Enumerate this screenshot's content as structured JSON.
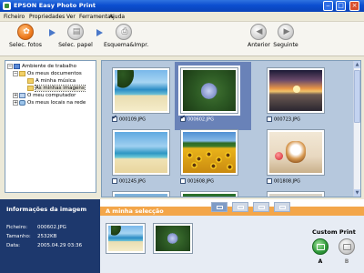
{
  "window": {
    "title": "EPSON Easy Photo Print"
  },
  "menu": [
    "Ficheiro",
    "Propriedades",
    "Ver",
    "Ferramentas",
    "Ajuda"
  ],
  "toolbar": {
    "steps": [
      {
        "label": "Selec. fotos",
        "icon": "photo-select-icon",
        "state": "active"
      },
      {
        "label": "Selec. papel",
        "icon": "paper-icon",
        "state": "idle"
      },
      {
        "label": "Esquema&Impr.",
        "icon": "print-icon",
        "state": "idle"
      }
    ],
    "prev_label": "Anterior",
    "next_label": "Seguinte",
    "accent": "#ee7b1f"
  },
  "tree": {
    "items": [
      {
        "label": "Ambiente de trabalho",
        "icon": "desktop-icon",
        "expander": "−",
        "level": 0
      },
      {
        "label": "Os meus documentos",
        "icon": "folder-icon",
        "expander": "−",
        "level": 1
      },
      {
        "label": "A minha música",
        "icon": "folder-icon",
        "expander": "",
        "level": 2
      },
      {
        "label": "As minhas imagens",
        "icon": "folder-icon",
        "expander": "",
        "level": 2,
        "selected": true
      },
      {
        "label": "O meu computador",
        "icon": "computer-icon",
        "expander": "+",
        "level": 1
      },
      {
        "label": "Os meus locais na rede",
        "icon": "network-icon",
        "expander": "+",
        "level": 1
      }
    ]
  },
  "thumbnails": [
    {
      "file": "000109.JPG",
      "checked": true,
      "selected": false,
      "photo": "beach"
    },
    {
      "file": "000602.JPG",
      "checked": true,
      "selected": true,
      "photo": "flower"
    },
    {
      "file": "000723.JPG",
      "checked": false,
      "selected": false,
      "photo": "sunset"
    },
    {
      "file": "001245.JPG",
      "checked": false,
      "selected": false,
      "photo": "island"
    },
    {
      "file": "001608.JPG",
      "checked": false,
      "selected": false,
      "photo": "sunflower"
    },
    {
      "file": "001808.JPG",
      "checked": false,
      "selected": false,
      "photo": "dog"
    }
  ],
  "info": {
    "title": "Informações da imagem",
    "file_label": "Ficheiro:",
    "file_value": "000602.JPG",
    "size_label": "Tamanho:",
    "size_value": "2532KB",
    "date_label": "Data:",
    "date_value": "2005.04.29 03:36"
  },
  "selection": {
    "title": "A minha selecção",
    "items": [
      "beach",
      "flower"
    ],
    "accent": "#f3a64a"
  },
  "custom_print": {
    "title": "Custom Print",
    "a_label": "A",
    "b_label": "B"
  }
}
